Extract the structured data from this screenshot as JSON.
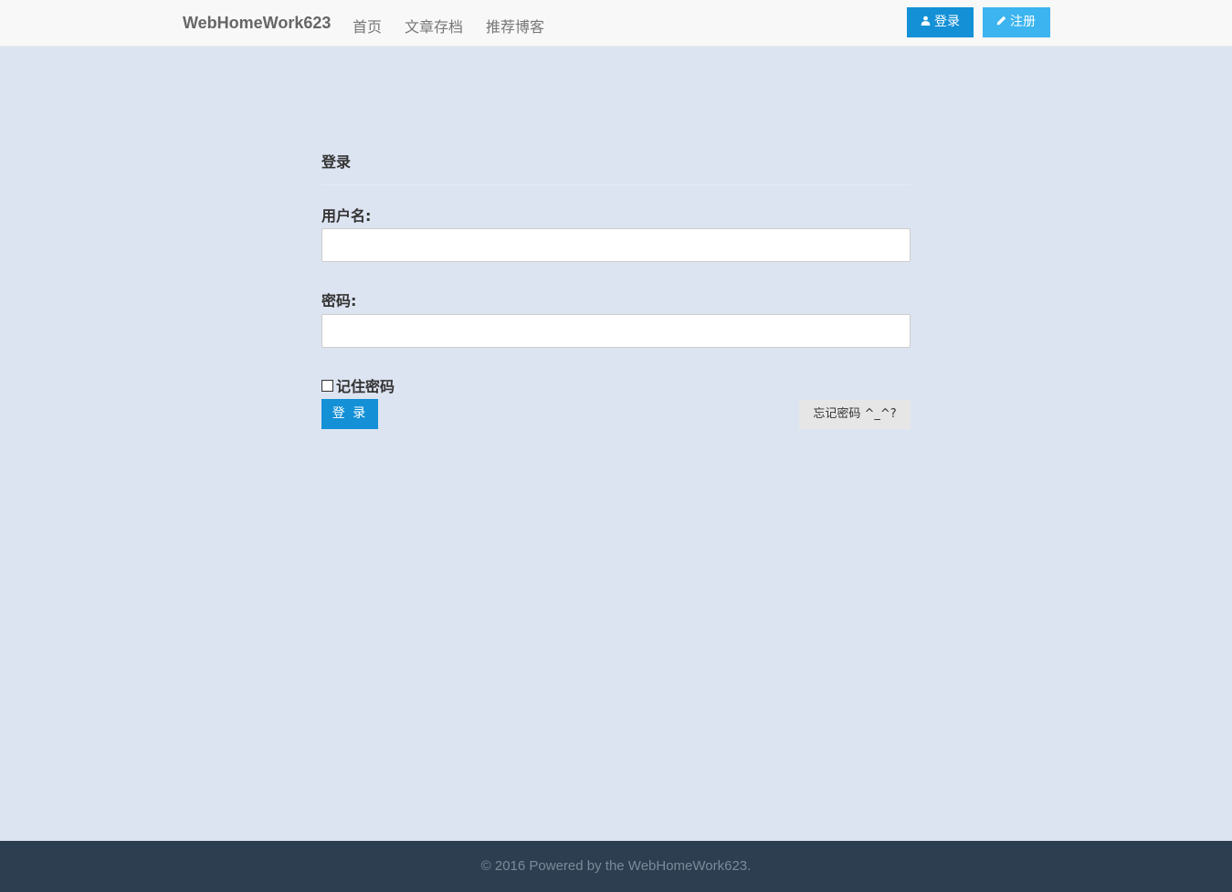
{
  "nav": {
    "brand": "WebHomeWork623",
    "links": [
      "首页",
      "文章存档",
      "推荐博客"
    ],
    "login_label": "登录",
    "register_label": "注册"
  },
  "form": {
    "title": "登录",
    "username_label": "用户名:",
    "username_value": "",
    "password_label": "密码:",
    "password_value": "",
    "remember_label": "记住密码",
    "remember_checked": false,
    "submit_label": "登 录",
    "forgot_label": "忘记密码 ^_^?"
  },
  "footer": {
    "text": "© 2016 Powered by the WebHomeWork623."
  },
  "colors": {
    "page_bg": "#dde4f1",
    "primary": "#1490d6",
    "register": "#3bb4ef",
    "footer_bg": "#2c3e50"
  }
}
